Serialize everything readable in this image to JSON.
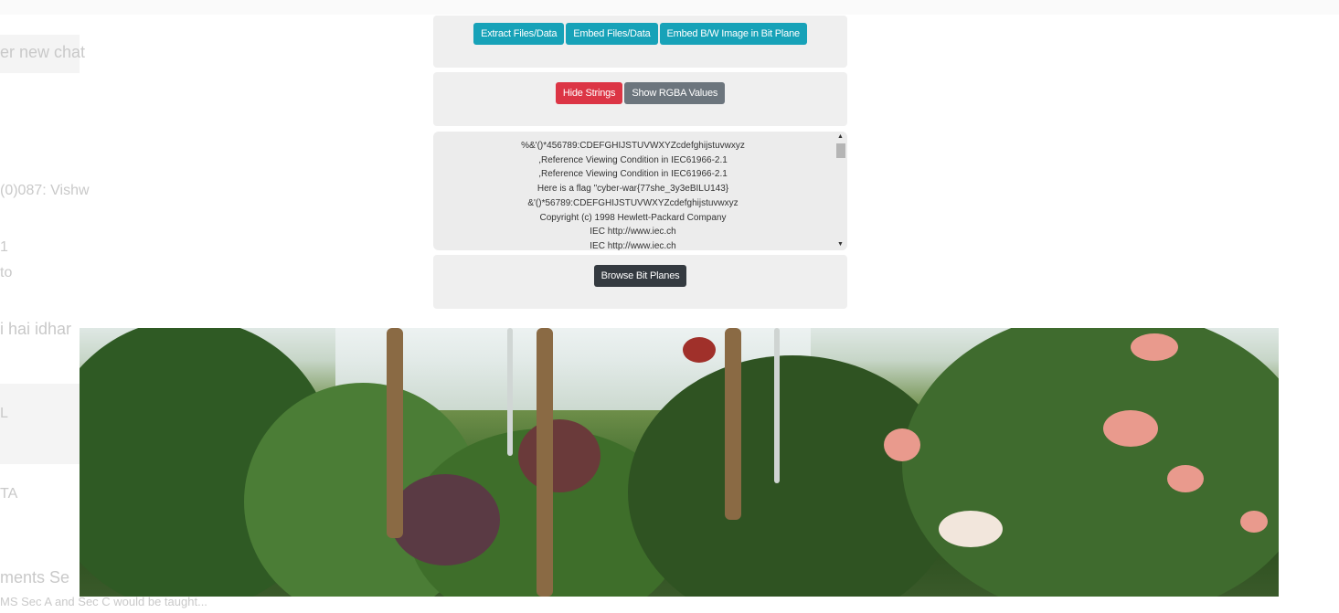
{
  "background_fragments": [
    "er new chat",
    "(0)087: Vishw",
    "1",
    "to",
    "i hai idhar",
    "L",
    "TA",
    "ments Se",
    "MS Sec A and Sec C would be taught..."
  ],
  "actions": {
    "extract_label": "Extract Files/Data",
    "embed_label": "Embed Files/Data",
    "embed_bw_label": "Embed B/W Image in Bit Plane"
  },
  "strings_controls": {
    "hide_label": "Hide Strings",
    "rgba_label": "Show RGBA Values"
  },
  "strings_output": [
    "%&'()*456789:CDEFGHIJSTUVWXYZcdefghijstuvwxyz",
    ",Reference Viewing Condition in IEC61966-2.1",
    ",Reference Viewing Condition in IEC61966-2.1",
    "Here is a flag \"cyber-war{77she_3y3eBILU143}",
    "&'()*56789:CDEFGHIJSTUVWXYZcdefghijstuvwxyz",
    "Copyright (c) 1998 Hewlett-Packard Company",
    "IEC http://www.iec.ch",
    "IEC http://www.iec.ch"
  ],
  "bitplanes": {
    "browse_label": "Browse Bit Planes"
  },
  "image": {
    "icon": "greenhouse-plants-photo",
    "colors": {
      "accent_info": "#17a2b8",
      "danger": "#dc3545",
      "secondary": "#6c757d",
      "dark": "#343a40"
    }
  }
}
